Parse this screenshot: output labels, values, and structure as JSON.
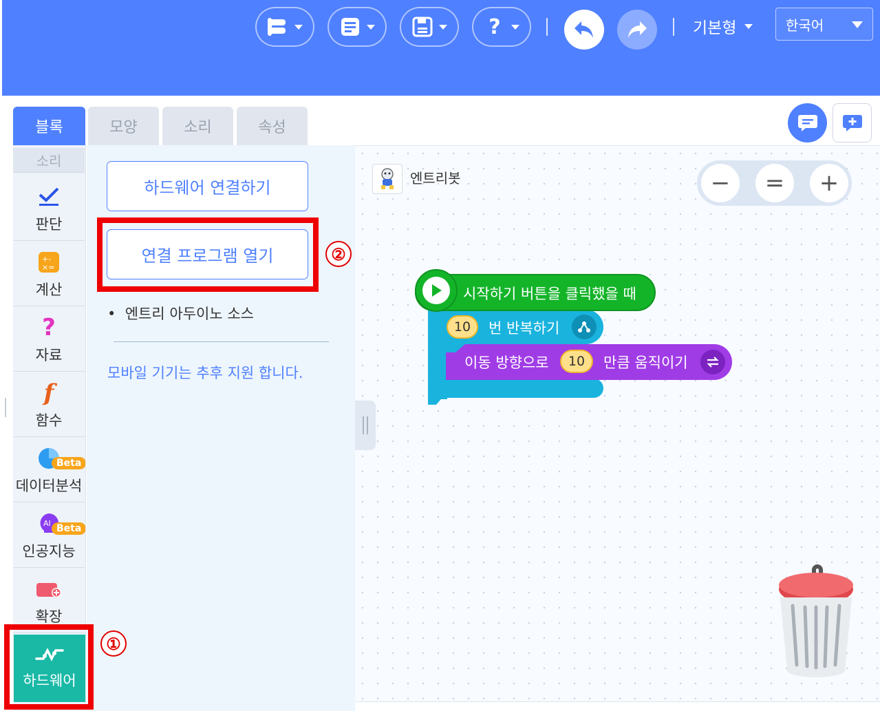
{
  "header": {
    "mode_label": "기본형",
    "language_label": "한국어",
    "background_color": "#4f80ff",
    "toolbar_icons": [
      "project-menu-icon",
      "document-icon",
      "save-icon",
      "help-icon",
      "undo-icon",
      "redo-icon"
    ]
  },
  "tabs": [
    {
      "label": "블록",
      "active": true
    },
    {
      "label": "모양",
      "active": false
    },
    {
      "label": "소리",
      "active": false
    },
    {
      "label": "속성",
      "active": false
    }
  ],
  "categories": {
    "partial_label": "소리",
    "items": [
      {
        "label": "판단",
        "icon": "check-icon"
      },
      {
        "label": "계산",
        "icon": "calculator-icon"
      },
      {
        "label": "자료",
        "icon": "question-icon"
      },
      {
        "label": "함수",
        "icon": "function-icon"
      },
      {
        "label": "데이터분석",
        "icon": "pie-chart-icon",
        "badge": "Beta"
      },
      {
        "label": "인공지능",
        "icon": "ai-head-icon",
        "badge": "Beta"
      },
      {
        "label": "확장",
        "icon": "extension-icon"
      }
    ],
    "hardware": {
      "label": "하드웨어",
      "icon": "hardware-link-icon",
      "color": "#1ab9a6"
    }
  },
  "palette": {
    "connect_button": "하드웨어 연결하기",
    "open_program_button": "연결 프로그램 열기",
    "source_item": "엔트리 아두이노 소스",
    "mobile_note": "모바일 기기는 추후 지원 합니다."
  },
  "workspace": {
    "object_name": "엔트리봇",
    "zoom": {
      "out": "−",
      "reset": "=",
      "in": "+"
    },
    "blocks": {
      "start_label": "시작하기 버튼을 클릭했을 때",
      "repeat_count": "10",
      "repeat_label": "번 반복하기",
      "move_label_before": "이동 방향으로",
      "move_value": "10",
      "move_label_after": "만큼 움직이기"
    }
  },
  "annotations": {
    "step1": "①",
    "step2": "②",
    "color": "#ee0000"
  }
}
